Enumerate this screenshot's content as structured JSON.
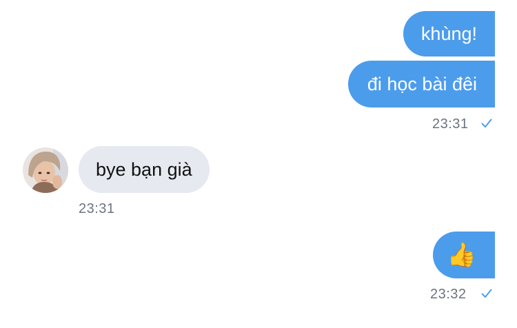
{
  "messages": [
    {
      "direction": "outgoing",
      "text": "khùng!"
    },
    {
      "direction": "outgoing",
      "text": "đi học bài đêi",
      "time": "23:31",
      "status": "sent-check"
    },
    {
      "direction": "incoming",
      "text": "bye bạn già",
      "time": "23:31",
      "avatar": "user-avatar"
    },
    {
      "direction": "outgoing",
      "text": "👍",
      "time": "23:32",
      "status": "sent-check"
    }
  ],
  "colors": {
    "outgoing_bubble": "#4c9cec",
    "incoming_bubble": "#e6e9f0",
    "timestamp": "#6b7380",
    "check": "#4c9cec"
  }
}
